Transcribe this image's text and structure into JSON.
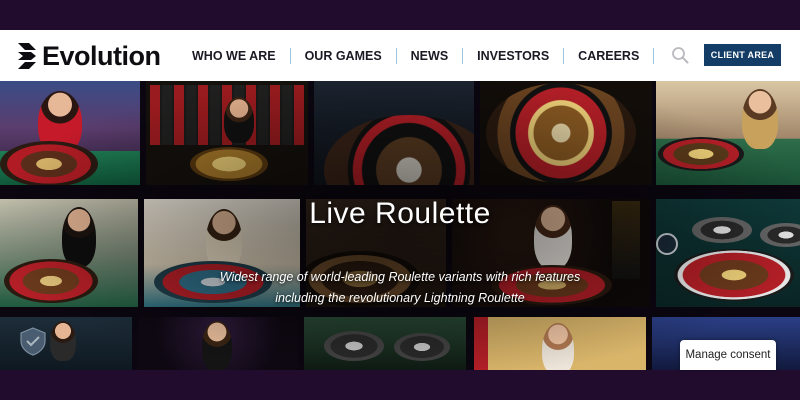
{
  "brand": {
    "name": "Evolution"
  },
  "nav": {
    "items": [
      {
        "label": "WHO WE ARE"
      },
      {
        "label": "OUR GAMES"
      },
      {
        "label": "NEWS"
      },
      {
        "label": "INVESTORS"
      },
      {
        "label": "CAREERS"
      }
    ]
  },
  "header": {
    "client_area_label": "CLIENT AREA"
  },
  "hero": {
    "title": "Live Roulette",
    "subtitle_line1": "Widest range of world-leading Roulette variants with rich features",
    "subtitle_line2": "including the revolutionary Lightning Roulette"
  },
  "consent": {
    "label": "Manage consent"
  },
  "colors": {
    "page_band": "#210c2e",
    "client_button": "#133d67",
    "nav_divider": "#9ec4df"
  },
  "icons": {
    "search": "search-icon",
    "logo": "evolution-logo-icon",
    "badge": "shield-badge-icon"
  }
}
